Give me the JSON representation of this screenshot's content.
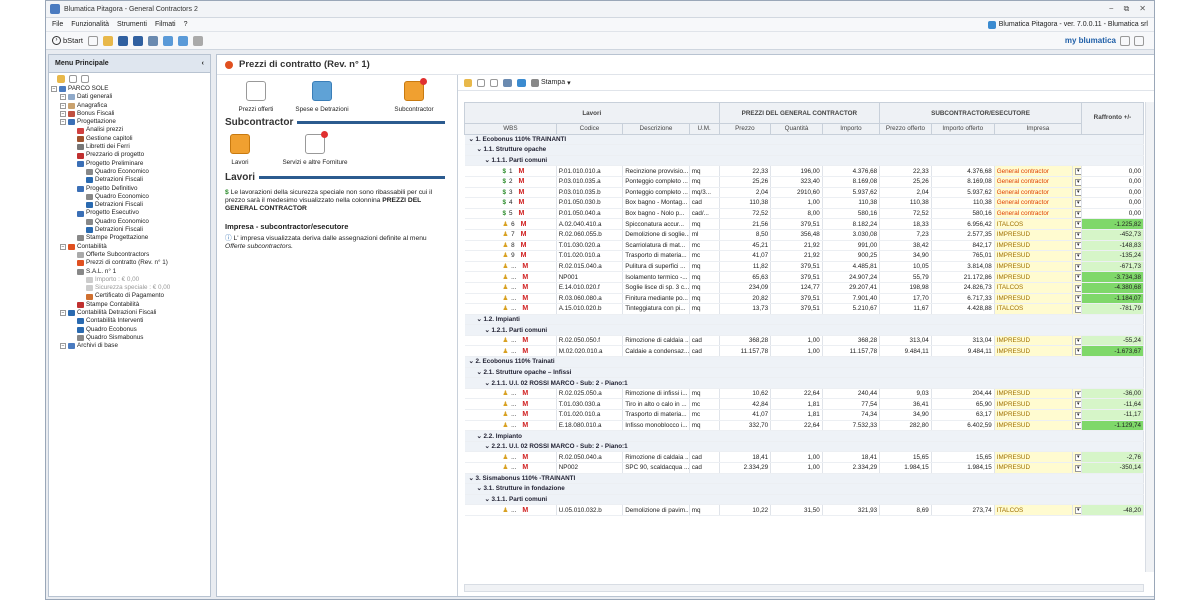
{
  "window": {
    "title": "Blumatica Pitagora - General Contractors 2",
    "version": "Blumatica Pitagora - ver. 7.0.0.11 - Blumatica srl"
  },
  "menu": [
    "File",
    "Funzionalità",
    "Strumenti",
    "Filmati",
    "?"
  ],
  "toolbar": {
    "bstart": "bStart",
    "brand": "my blumatica"
  },
  "left": {
    "title": "Menu Principale",
    "collapse": "‹",
    "tree": [
      {
        "label": "PARCO SOLE",
        "lvl": 0,
        "c": "#4a7bc0"
      },
      {
        "label": "Dati generali",
        "lvl": 1,
        "c": "#8fa9c9"
      },
      {
        "label": "Anagrafica",
        "lvl": 1,
        "c": "#c9a26f"
      },
      {
        "label": "Bonus Fiscali",
        "lvl": 1,
        "c": "#c05040"
      },
      {
        "label": "Progettazione",
        "lvl": 1,
        "c": "#3b6fb6"
      },
      {
        "label": "Analisi prezzi",
        "lvl": 2,
        "c": "#d04040"
      },
      {
        "label": "Gestione capitoli",
        "lvl": 2,
        "c": "#a0522d"
      },
      {
        "label": "Libretti dei Ferri",
        "lvl": 2,
        "c": "#777"
      },
      {
        "label": "Prezzario di progetto",
        "lvl": 2,
        "c": "#c03030"
      },
      {
        "label": "Progetto Preliminare",
        "lvl": 2,
        "c": "#3b6fb6"
      },
      {
        "label": "Quadro Economico",
        "lvl": 3,
        "c": "#888"
      },
      {
        "label": "Detrazioni Fiscali",
        "lvl": 3,
        "c": "#2a6ab0"
      },
      {
        "label": "Progetto Definitivo",
        "lvl": 2,
        "c": "#3b6fb6"
      },
      {
        "label": "Quadro Economico",
        "lvl": 3,
        "c": "#888"
      },
      {
        "label": "Detrazioni Fiscali",
        "lvl": 3,
        "c": "#2a6ab0"
      },
      {
        "label": "Progetto Esecutivo",
        "lvl": 2,
        "c": "#3b6fb6"
      },
      {
        "label": "Quadro Economico",
        "lvl": 3,
        "c": "#888"
      },
      {
        "label": "Detrazioni Fiscali",
        "lvl": 3,
        "c": "#2a6ab0"
      },
      {
        "label": "Stampe Progettazione",
        "lvl": 2,
        "c": "#888"
      },
      {
        "label": "Contabilità",
        "lvl": 1,
        "c": "#e05020"
      },
      {
        "label": "Offerte Subcontractors",
        "lvl": 2,
        "c": "#aaa"
      },
      {
        "label": "Prezzi di contratto (Rev. n° 1)",
        "lvl": 2,
        "c": "#e05020"
      },
      {
        "label": "S.A.L. n° 1",
        "lvl": 2,
        "c": "#888"
      },
      {
        "label": "Importo : € 0,00",
        "lvl": 3,
        "c": "#ccc",
        "dim": true
      },
      {
        "label": "Sicurezza speciale : € 0,00",
        "lvl": 3,
        "c": "#ccc",
        "dim": true
      },
      {
        "label": "Certificato di Pagamento",
        "lvl": 3,
        "c": "#d07030"
      },
      {
        "label": "Stampe Contabilità",
        "lvl": 2,
        "c": "#c03030"
      },
      {
        "label": "Contabilità Detrazioni Fiscali",
        "lvl": 1,
        "c": "#2a6ab0"
      },
      {
        "label": "Contabilità Interventi",
        "lvl": 2,
        "c": "#2a6ab0"
      },
      {
        "label": "Quadro Ecobonus",
        "lvl": 2,
        "c": "#2a6ab0"
      },
      {
        "label": "Quadro Sismabonus",
        "lvl": 2,
        "c": "#888"
      },
      {
        "label": "Archivi di base",
        "lvl": 1,
        "c": "#4a7bc0"
      }
    ]
  },
  "center": {
    "title": "Prezzi di contratto (Rev. n° 1)",
    "icons1": [
      "Prezzi offerti",
      "Spese e Detrazioni",
      "Subcontractor"
    ],
    "sub_title": "Subcontractor",
    "icons2": [
      "Lavori",
      "Servizi e altre Forniture"
    ],
    "lavori_title": "Lavori",
    "lavori_text_a": "Le lavorazioni della sicurezza speciale non sono ribassabili per cui il prezzo sarà il medesimo visualizzato nella colonnina",
    "lavori_text_b": "PREZZI DEL GENERAL CONTRACTOR",
    "impresa_title": "Impresa - subcontractor/esecutore",
    "impresa_text_a": "L' impresa visualizzata deriva dalle assegnazioni definite al menu",
    "impresa_text_b": "Offerte subcontractors."
  },
  "grid": {
    "stampa": "Stampa",
    "groups": [
      "Lavori",
      "PREZZI DEL GENERAL CONTRACTOR",
      "SUBCONTRACTOR/ESECUTORE",
      "Raffronto +/-"
    ],
    "cols": [
      "WBS",
      "Codice",
      "Descrizione",
      "U.M.",
      "Prezzo",
      "Quantità",
      "Importo",
      "Prezzo offerto",
      "Importo offerto",
      "Impresa"
    ],
    "rows": [
      {
        "g": "1. Ecobonus 110% TRAINANTI",
        "l": 0
      },
      {
        "g": "1.1. Strutture opache",
        "l": 1
      },
      {
        "g": "1.1.1. Parti comuni",
        "l": 2
      },
      {
        "w": "1",
        "k": "S",
        "c": "P.01.010.010.a",
        "d": "Recinzione provvisio...",
        "u": "mq",
        "p": "22,33",
        "q": "196,00",
        "i": "4.376,68",
        "po": "22,33",
        "io": "4.376,68",
        "im": "General contractor",
        "r": "0,00",
        "t": "gc"
      },
      {
        "w": "2",
        "k": "S",
        "c": "P.03.010.035.a",
        "d": "Ponteggio completo ...",
        "u": "mq",
        "p": "25,26",
        "q": "323,40",
        "i": "8.169,08",
        "po": "25,26",
        "io": "8.169,08",
        "im": "General contractor",
        "r": "0,00",
        "t": "gc"
      },
      {
        "w": "3",
        "k": "S",
        "c": "P.03.010.035.b",
        "d": "Ponteggio completo ...",
        "u": "mq/3...",
        "p": "2,04",
        "q": "2910,60",
        "i": "5.937,62",
        "po": "2,04",
        "io": "5.937,62",
        "im": "General contractor",
        "r": "0,00",
        "t": "gc"
      },
      {
        "w": "4",
        "k": "S",
        "c": "P.01.050.030.b",
        "d": "Box bagno - Montag...",
        "u": "cad",
        "p": "110,38",
        "q": "1,00",
        "i": "110,38",
        "po": "110,38",
        "io": "110,38",
        "im": "General contractor",
        "r": "0,00",
        "t": "gc"
      },
      {
        "w": "5",
        "k": "S",
        "c": "P.01.050.040.a",
        "d": "Box bagno - Nolo  p...",
        "u": "cad/...",
        "p": "72,52",
        "q": "8,00",
        "i": "580,16",
        "po": "72,52",
        "io": "580,16",
        "im": "General contractor",
        "r": "0,00",
        "t": "gc"
      },
      {
        "w": "6",
        "k": "P",
        "c": "A.02.040.410.a",
        "d": "Spicconatura   accur...",
        "u": "mq",
        "p": "21,56",
        "q": "379,51",
        "i": "8.182,24",
        "po": "18,33",
        "io": "6.956,42",
        "im": "ITALCOS",
        "r": "-1.225,82",
        "t": "it"
      },
      {
        "w": "7",
        "k": "P",
        "c": "R.02.060.055.b",
        "d": "Demolizione di soglie...",
        "u": "ml",
        "p": "8,50",
        "q": "356,48",
        "i": "3.030,08",
        "po": "7,23",
        "io": "2.577,35",
        "im": "IMPRESUD",
        "r": "-452,73",
        "t": "it"
      },
      {
        "w": "8",
        "k": "P",
        "c": "T.01.030.020.a",
        "d": "Scarriolatura di mat...",
        "u": "mc",
        "p": "45,21",
        "q": "21,92",
        "i": "991,00",
        "po": "38,42",
        "io": "842,17",
        "im": "IMPRESUD",
        "r": "-148,83",
        "t": "it"
      },
      {
        "w": "9",
        "k": "P",
        "c": "T.01.020.010.a",
        "d": "Trasporto di materia...",
        "u": "mc",
        "p": "41,07",
        "q": "21,92",
        "i": "900,25",
        "po": "34,90",
        "io": "765,01",
        "im": "IMPRESUD",
        "r": "-135,24",
        "t": "it"
      },
      {
        "w": "...",
        "k": "P",
        "c": "R.02.015.040.a",
        "d": "Pulitura di superfici ...",
        "u": "mq",
        "p": "11,82",
        "q": "379,51",
        "i": "4.485,81",
        "po": "10,05",
        "io": "3.814,08",
        "im": "IMPRESUD",
        "r": "-671,73",
        "t": "it"
      },
      {
        "w": "...",
        "k": "P",
        "c": "NP001",
        "d": "Isolamento termico -...",
        "u": "mq",
        "p": "65,63",
        "q": "379,51",
        "i": "24.907,24",
        "po": "55,79",
        "io": "21.172,86",
        "im": "IMPRESUD",
        "r": "-3.734,38",
        "t": "it"
      },
      {
        "w": "...",
        "k": "P",
        "c": "E.14.010.020.f",
        "d": "Soglie lisce di sp. 3 c...",
        "u": "mq",
        "p": "234,09",
        "q": "124,77",
        "i": "29.207,41",
        "po": "198,98",
        "io": "24.826,73",
        "im": "ITALCOS",
        "r": "-4.380,68",
        "t": "it"
      },
      {
        "w": "...",
        "k": "P",
        "c": "R.03.060.080.a",
        "d": "Finitura mediante po...",
        "u": "mq",
        "p": "20,82",
        "q": "379,51",
        "i": "7.901,40",
        "po": "17,70",
        "io": "6.717,33",
        "im": "IMPRESUD",
        "r": "-1.184,07",
        "t": "it"
      },
      {
        "w": "...",
        "k": "P",
        "c": "A.15.010.020.b",
        "d": "Tinteggiatura con pi...",
        "u": "mq",
        "p": "13,73",
        "q": "379,51",
        "i": "5.210,67",
        "po": "11,67",
        "io": "4.428,88",
        "im": "ITALCOS",
        "r": "-781,79",
        "t": "it"
      },
      {
        "g": "1.2. Impianti",
        "l": 1
      },
      {
        "g": "1.2.1. Parti comuni",
        "l": 2
      },
      {
        "w": "...",
        "k": "P",
        "c": "R.02.050.050.f",
        "d": "Rimozione di caldaia ...",
        "u": "cad",
        "p": "368,28",
        "q": "1,00",
        "i": "368,28",
        "po": "313,04",
        "io": "313,04",
        "im": "IMPRESUD",
        "r": "-55,24",
        "t": "it"
      },
      {
        "w": "...",
        "k": "P",
        "c": "M.02.020.010.a",
        "d": "Caldaie a condensaz...",
        "u": "cad",
        "p": "11.157,78",
        "q": "1,00",
        "i": "11.157,78",
        "po": "9.484,11",
        "io": "9.484,11",
        "im": "IMPRESUD",
        "r": "-1.673,67",
        "t": "it"
      },
      {
        "g": "2. Ecobonus 110% Trainati",
        "l": 0
      },
      {
        "g": "2.1. Strutture opache – Infissi",
        "l": 1
      },
      {
        "g": "2.1.1. U.I. 02 ROSSI MARCO - Sub: 2 - Piano:1",
        "l": 2
      },
      {
        "w": "...",
        "k": "P",
        "c": "R.02.025.050.a",
        "d": "Rimozione di infissi i...",
        "u": "mq",
        "p": "10,62",
        "q": "22,64",
        "i": "240,44",
        "po": "9,03",
        "io": "204,44",
        "im": "IMPRESUD",
        "r": "-36,00",
        "t": "it"
      },
      {
        "w": "...",
        "k": "P",
        "c": "T.01.030.030.a",
        "d": "Tiro in alto o calo in ...",
        "u": "mc",
        "p": "42,84",
        "q": "1,81",
        "i": "77,54",
        "po": "36,41",
        "io": "65,90",
        "im": "IMPRESUD",
        "r": "-11,64",
        "t": "it"
      },
      {
        "w": "...",
        "k": "P",
        "c": "T.01.020.010.a",
        "d": "Trasporto di materia...",
        "u": "mc",
        "p": "41,07",
        "q": "1,81",
        "i": "74,34",
        "po": "34,90",
        "io": "63,17",
        "im": "IMPRESUD",
        "r": "-11,17",
        "t": "it"
      },
      {
        "w": "...",
        "k": "P",
        "c": "E.18.080.010.a",
        "d": "Infisso monoblocco i...",
        "u": "mq",
        "p": "332,70",
        "q": "22,64",
        "i": "7.532,33",
        "po": "282,80",
        "io": "6.402,59",
        "im": "IMPRESUD",
        "r": "-1.129,74",
        "t": "it"
      },
      {
        "g": "2.2. Impianto",
        "l": 1
      },
      {
        "g": "2.2.1. U.I. 02 ROSSI MARCO - Sub: 2 - Piano:1",
        "l": 2
      },
      {
        "w": "...",
        "k": "P",
        "c": "R.02.050.040.a",
        "d": "Rimozione di caldaia ...",
        "u": "cad",
        "p": "18,41",
        "q": "1,00",
        "i": "18,41",
        "po": "15,65",
        "io": "15,65",
        "im": "IMPRESUD",
        "r": "-2,76",
        "t": "it"
      },
      {
        "w": "...",
        "k": "P",
        "c": "NP002",
        "d": "SPC 90, scaldacqua ...",
        "u": "cad",
        "p": "2.334,29",
        "q": "1,00",
        "i": "2.334,29",
        "po": "1.984,15",
        "io": "1.984,15",
        "im": "IMPRESUD",
        "r": "-350,14",
        "t": "it"
      },
      {
        "g": "3. Sismabonus 110% -TRAINANTI",
        "l": 0
      },
      {
        "g": "3.1. Strutture in fondazione",
        "l": 1
      },
      {
        "g": "3.1.1. Parti comuni",
        "l": 2
      },
      {
        "w": "...",
        "k": "P",
        "c": "U.05.010.032.b",
        "d": "Demolizione di pavim...",
        "u": "mq",
        "p": "10,22",
        "q": "31,50",
        "i": "321,93",
        "po": "8,69",
        "io": "273,74",
        "im": "ITALCOS",
        "r": "-48,20",
        "t": "it"
      }
    ]
  }
}
